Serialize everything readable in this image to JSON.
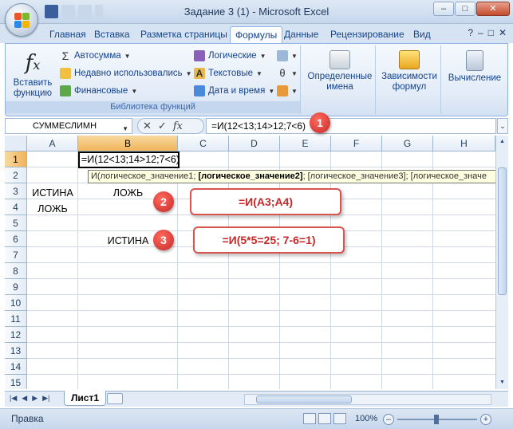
{
  "window": {
    "title": "Задание 3 (1) - Microsoft Excel",
    "min": "–",
    "max": "□",
    "close": "✕"
  },
  "tabs": [
    {
      "label": "Главная"
    },
    {
      "label": "Вставка"
    },
    {
      "label": "Разметка страницы"
    },
    {
      "label": "Формулы"
    },
    {
      "label": "Данные"
    },
    {
      "label": "Рецензирование"
    },
    {
      "label": "Вид"
    }
  ],
  "ribbon": {
    "insert_function": "Вставить функцию",
    "autosum": "Автосумма",
    "recent": "Недавно использовались",
    "financial": "Финансовые",
    "logical": "Логические",
    "text": "Текстовые",
    "datetime": "Дата и время",
    "group_label": "Библиотека функций",
    "defined_names": "Определенные имена",
    "dependencies": "Зависимости формул",
    "calculation": "Вычисление"
  },
  "formula_bar": {
    "name_box": "СУММЕСЛИМН",
    "cancel": "✕",
    "enter": "✓",
    "fx": "fx",
    "formula": "=И(12<13;14>12;7<6)"
  },
  "grid": {
    "columns": [
      "A",
      "B",
      "C",
      "D",
      "E",
      "F",
      "G",
      "H"
    ],
    "rows": [
      "1",
      "2",
      "3",
      "4",
      "5",
      "6",
      "7",
      "8",
      "9",
      "10",
      "11",
      "12",
      "13",
      "14",
      "15"
    ],
    "active_cell_text": "=И(12<13;14>12;7<6)",
    "tooltip_prefix": "И(логическое_значение1; ",
    "tooltip_bold": "[логическое_значение2]",
    "tooltip_suffix": "; [логическое_значение3]; [логическое_значе",
    "cells": {
      "A3": "ИСТИНА",
      "B3": "ЛОЖЬ",
      "A4": "ЛОЖЬ",
      "B6": "ИСТИНА"
    }
  },
  "callouts": {
    "badge1": "1",
    "badge2": "2",
    "badge3": "3",
    "formula2": "=И(A3;A4)",
    "formula3": "=И(5*5=25; 7-6=1)"
  },
  "sheets": {
    "active": "Лист1"
  },
  "status": {
    "text": "Правка",
    "zoom": "100%"
  },
  "colors": {
    "accent_red": "#c62828",
    "selection_orange": "#f0b45a",
    "ribbon_blue": "#15428b"
  }
}
